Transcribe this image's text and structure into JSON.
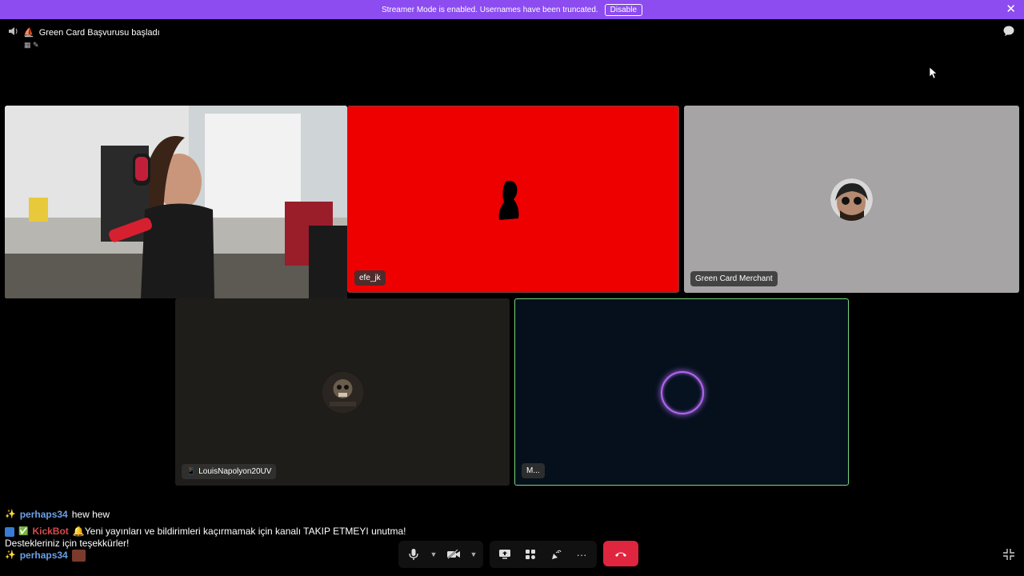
{
  "banner": {
    "message": "Streamer Mode is enabled. Usernames have been truncated.",
    "disable_label": "Disable",
    "close_glyph": "✕"
  },
  "channel": {
    "title": "Green Card Başvurusu başladı",
    "title_icon": "⛵",
    "sub_icons": "▦ ✎"
  },
  "tiles": [
    {
      "name": "",
      "type": "webcam"
    },
    {
      "name": "efe_jk",
      "type": "video",
      "color": "#ee0000"
    },
    {
      "name": "Green Card Merchant",
      "type": "avatar",
      "color": "#a7a4a5"
    },
    {
      "name": "LouisNapolyon20UV",
      "type": "avatar",
      "color": "#1f1d1a",
      "device_icon": "📱"
    },
    {
      "name": "M...",
      "type": "speaking",
      "color": "#05101c",
      "ring_color": "#b066f0"
    }
  ],
  "chat": [
    {
      "icon": "✨",
      "user": "perhaps34",
      "text": "hew hew"
    },
    {
      "icon": "✅",
      "user": "KickBot",
      "text": "🔔Yeni yayınları ve bildirimleri kaçırmamak için kanalı TAKIP ETMEYI unutma!",
      "continuation": "Destekleriniz için teşekkürler!"
    },
    {
      "icon": "✨",
      "user": "perhaps34",
      "text": ""
    }
  ],
  "controls": {
    "mic": "mic-icon",
    "camera": "camera-off-icon",
    "screenshare": "screen-share-icon",
    "activities": "activities-icon",
    "soundboard": "soundboard-icon",
    "more_glyph": "···",
    "end_call": "end-call-icon"
  },
  "colors": {
    "banner": "#8c4cf0",
    "accent_border": "#7bd67f",
    "end_call": "#e0253f",
    "username": "#6ba0e8",
    "bot": "#d64b4b"
  }
}
